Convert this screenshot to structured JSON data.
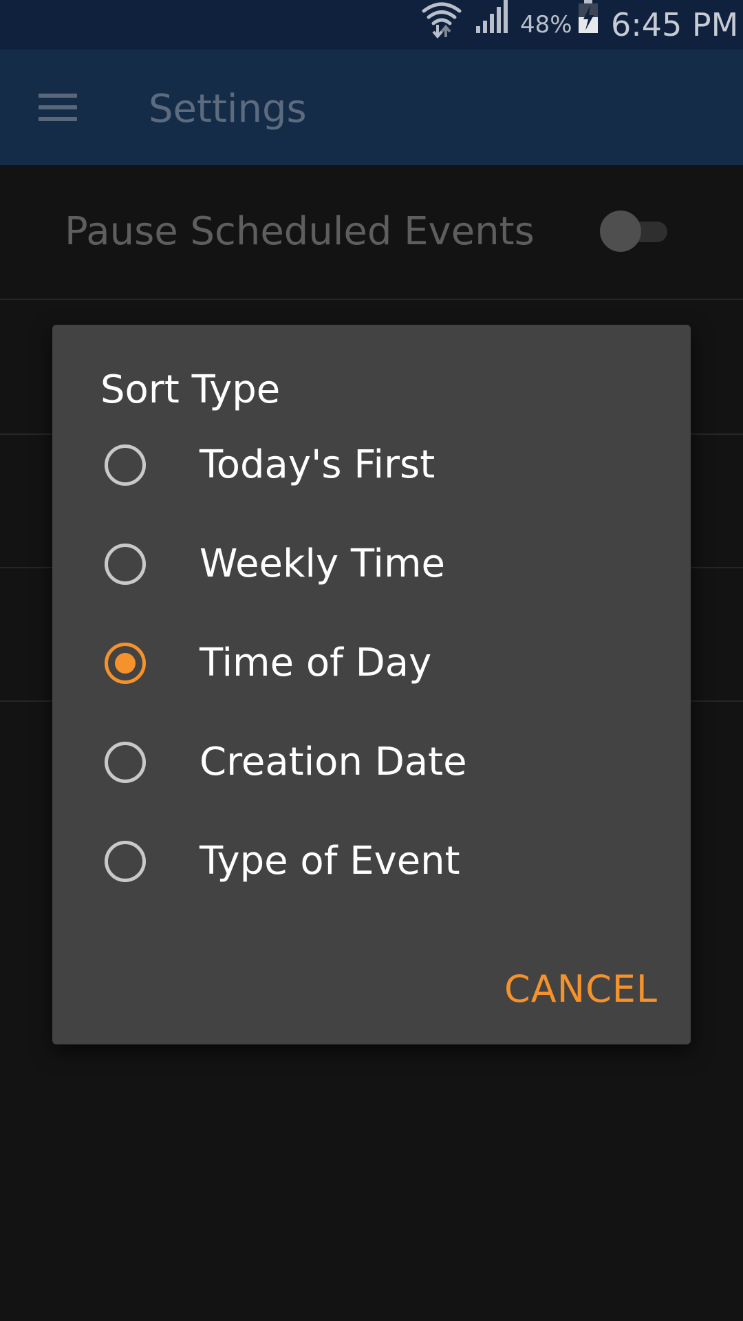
{
  "status_bar": {
    "battery_percent": "48%",
    "time": "6:45 PM",
    "wifi_icon": "wifi-icon",
    "signal_icon": "signal-icon",
    "battery_icon": "battery-charging-icon",
    "battery_level": 0.48
  },
  "app_bar": {
    "title": "Settings",
    "menu_icon": "hamburger-menu-icon"
  },
  "settings": {
    "pause_label": "Pause Scheduled Events",
    "pause_enabled": false
  },
  "dialog": {
    "title": "Sort Type",
    "options": [
      {
        "label": "Today's First",
        "selected": false
      },
      {
        "label": "Weekly Time",
        "selected": false
      },
      {
        "label": "Time of Day",
        "selected": true
      },
      {
        "label": "Creation Date",
        "selected": false
      },
      {
        "label": "Type of Event",
        "selected": false
      }
    ],
    "cancel_label": "CANCEL"
  },
  "colors": {
    "status_bar_bg": "#0f213c",
    "app_bar_bg": "#152c49",
    "background": "#131313",
    "dialog_bg": "#434343",
    "accent": "#f5922b",
    "radio_unchecked": "#c9c9c9"
  }
}
